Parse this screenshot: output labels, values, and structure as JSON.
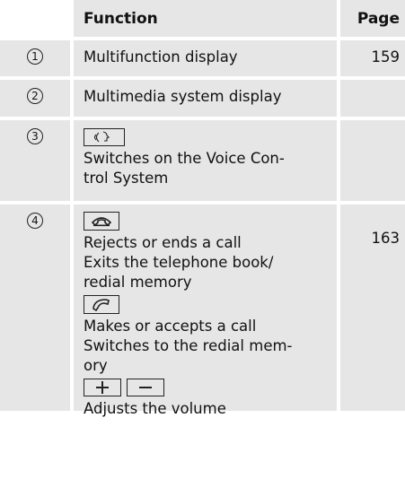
{
  "header": {
    "function": "Function",
    "page": "Page"
  },
  "rows": [
    {
      "num": "1",
      "lines": [
        "Multifunction display"
      ],
      "page": "159"
    },
    {
      "num": "2",
      "lines": [
        "Multimedia system display"
      ],
      "page": ""
    },
    {
      "num": "3",
      "lines": [
        "Switches on the Voice Con-",
        "trol System"
      ],
      "page": ""
    },
    {
      "num": "4",
      "page": "163",
      "line1": "Rejects or ends a call",
      "line2": "Exits the telephone book/",
      "line3": "redial memory",
      "line4": "Makes or accepts a call",
      "line5": "Switches to the redial mem-",
      "line6": "ory",
      "line7": "Adjusts the volume"
    }
  ],
  "icons": {
    "voice": "voice-control-icon",
    "end_call": "end-call-icon",
    "accept_call": "accept-call-icon",
    "plus": "volume-up-icon",
    "minus": "volume-down-icon"
  },
  "colors": {
    "cell_bg": "#e6e6e6",
    "text": "#111111"
  }
}
